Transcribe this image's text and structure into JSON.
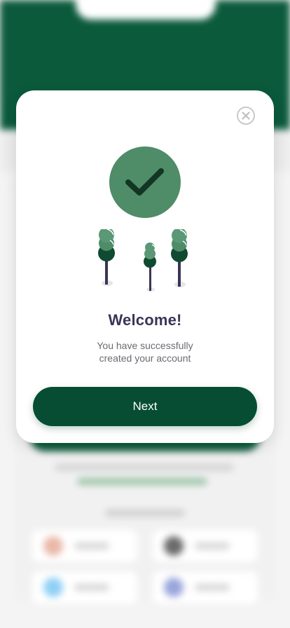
{
  "background": {
    "header_color": "#0b5a3c",
    "header_title": "",
    "note": ""
  },
  "modal": {
    "close_icon": "close-icon",
    "illustration": {
      "check_icon": "checkmark-icon",
      "check_color": "#4f8c68",
      "trees_icon": "trees-icon"
    },
    "title": "Welcome!",
    "subtitle_line1": "You have successfully",
    "subtitle_line2": "created your account",
    "primary_button_label": "Next",
    "primary_color": "#064d33"
  }
}
